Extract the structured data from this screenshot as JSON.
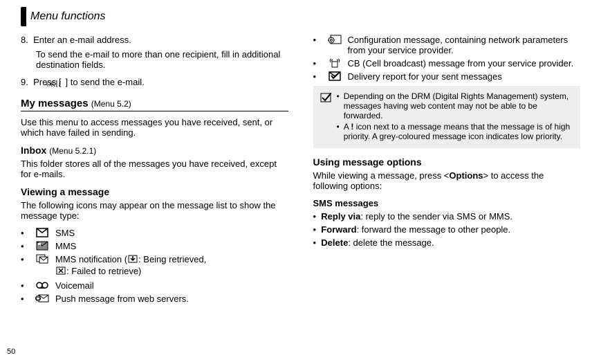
{
  "header": {
    "title": "Menu functions"
  },
  "page_number": "50",
  "left": {
    "step8_num": "8.",
    "step8": "Enter an e-mail address.",
    "step8_sub": "To send the e-mail to more than one recipient, fill in additional destination fields.",
    "step9_num": "9.",
    "step9_a": "Press [",
    "step9_b": "] to send the e-mail.",
    "my_messages": "My messages",
    "my_messages_sub": "(Menu 5.2)",
    "my_messages_body": "Use this menu to access messages you have received, sent, or which have failed in sending.",
    "inbox": "Inbox",
    "inbox_sub": "(Menu 5.2.1)",
    "inbox_body": "This folder stores all of the messages you have received, except for e-mails.",
    "viewing_heading": "Viewing a message",
    "viewing_body": "The following icons may appear on the message list to show the message type:",
    "icons": {
      "sms": "SMS",
      "mms": "MMS",
      "mms_notif_a": "MMS notification (",
      "mms_notif_b": ": Being retrieved,",
      "mms_notif_c": ": Failed to retrieve)",
      "voicemail": "Voicemail",
      "push": "Push message from web servers."
    }
  },
  "right": {
    "icons": {
      "config": "Configuration message, containing network parameters from your service provider.",
      "cb": "CB (Cell broadcast) message from your service provider.",
      "delivery": "Delivery report for your sent messages"
    },
    "note1": "Depending on the DRM (Digital Rights Management) system, messages having web content may not be able to be forwarded.",
    "note2_a": "A ",
    "note2_b": "!",
    "note2_c": " icon next to a message means that the message is of high priority. A grey-coloured message icon indicates low priority.",
    "using_heading": "Using message options",
    "using_body_a": "While viewing a message, press <",
    "using_body_b": "Options",
    "using_body_c": "> to access the following options:",
    "sms_heading": "SMS messages",
    "reply_label": "Reply via",
    "reply_text": ": reply to the sender via SMS or MMS.",
    "forward_label": "Forward",
    "forward_text": ": forward the message to other people.",
    "delete_label": "Delete",
    "delete_text": ": delete the message."
  }
}
